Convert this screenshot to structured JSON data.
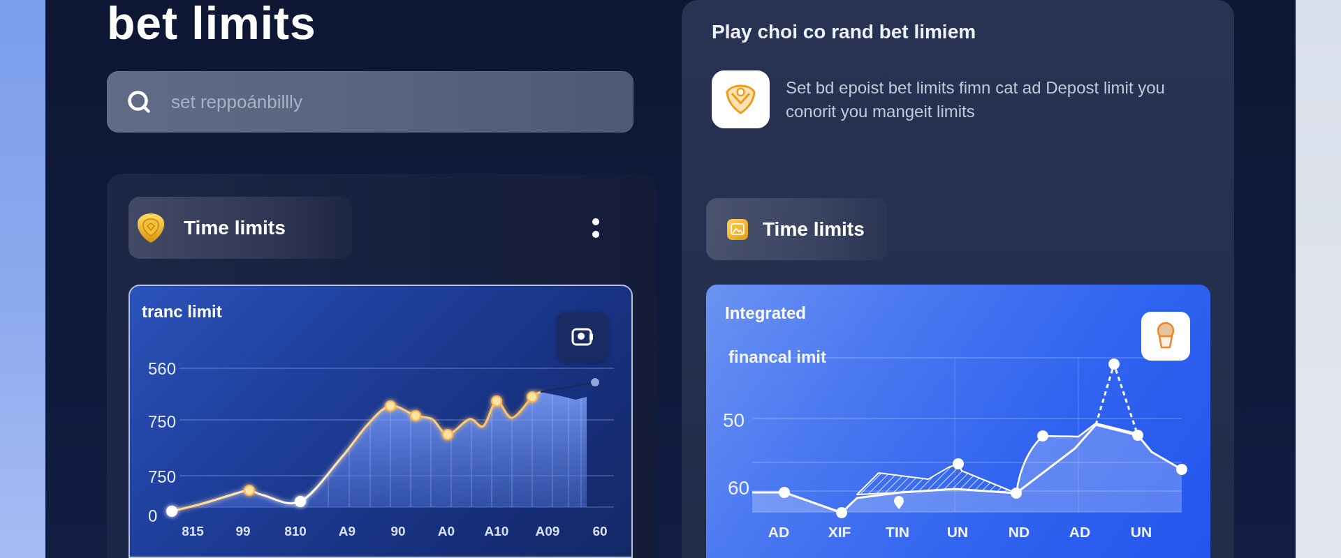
{
  "page": {
    "title": "bet limits"
  },
  "search": {
    "placeholder": "set reppoánbillly"
  },
  "left_card": {
    "header": {
      "label": "Time limits"
    },
    "chart": {
      "title": "tranc limit",
      "y_labels": [
        "560",
        "750",
        "750",
        "0"
      ],
      "x_labels": [
        "815",
        "99",
        "810",
        "A9",
        "90",
        "A0",
        "A10",
        "A09",
        "60"
      ]
    }
  },
  "right_card": {
    "title": "Play choi co rand bet limiem",
    "description": "Set bd epoist bet limits fimn cat ad Depost limit you conorit you mangeit limits",
    "header": {
      "label": "Time limits"
    },
    "chart": {
      "title": "Integrated",
      "subtitle": "financal imit",
      "y_labels": [
        "50",
        "60"
      ],
      "x_labels": [
        "AD",
        "XIF",
        "TIN",
        "UN",
        "ND",
        "AD",
        "UN"
      ]
    }
  }
}
